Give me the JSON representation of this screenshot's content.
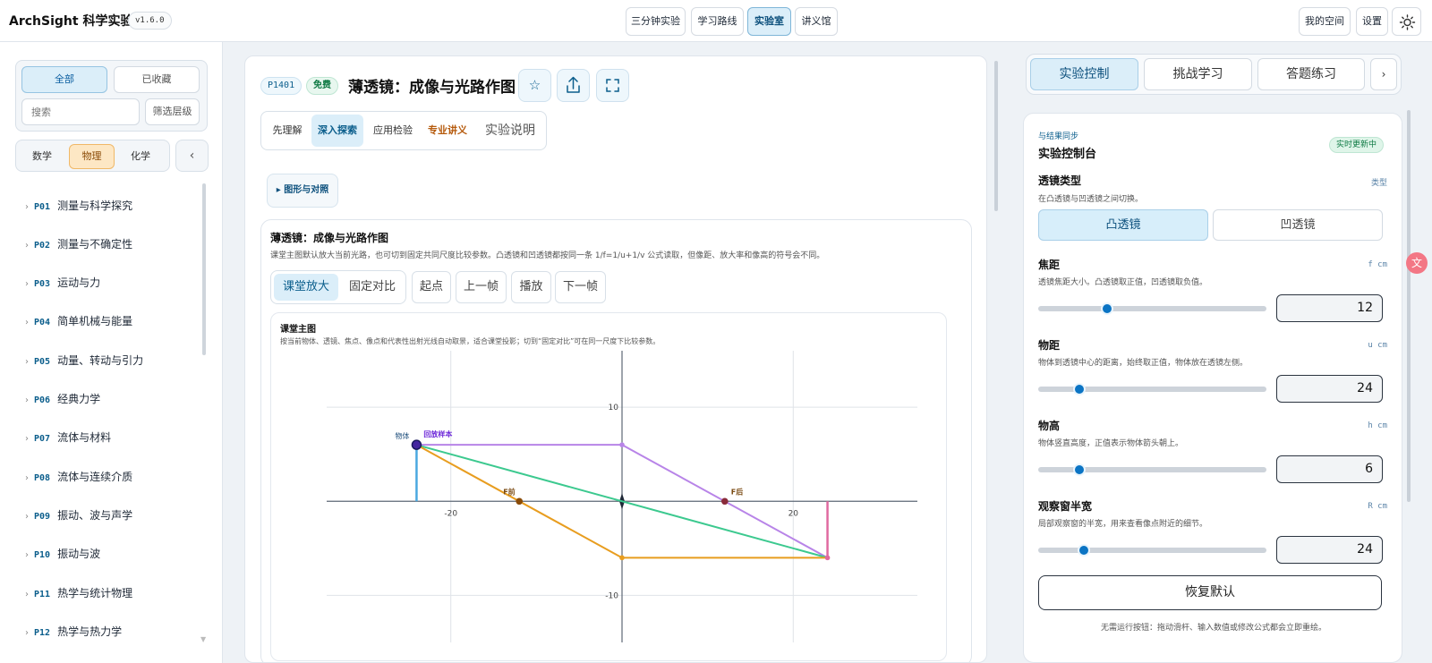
{
  "header": {
    "brand": "ArchSight 科学实验室",
    "version": "v1.6.0",
    "nav": [
      "三分钟实验",
      "学习路线",
      "实验室",
      "讲义馆"
    ],
    "nav_active": "实验室",
    "right": [
      "我的空间",
      "设置"
    ]
  },
  "sidebar": {
    "filter_all": "全部",
    "filter_fav": "已收藏",
    "search_placeholder": "搜索",
    "filter_level": "筛选层级",
    "subjects": [
      "数学",
      "物理",
      "化学"
    ],
    "subject_active": "物理",
    "collapse": "‹",
    "topics": [
      {
        "code": "P01",
        "name": "测量与科学探究"
      },
      {
        "code": "P02",
        "name": "测量与不确定性"
      },
      {
        "code": "P03",
        "name": "运动与力"
      },
      {
        "code": "P04",
        "name": "简单机械与能量"
      },
      {
        "code": "P05",
        "name": "动量、转动与引力"
      },
      {
        "code": "P06",
        "name": "经典力学"
      },
      {
        "code": "P07",
        "name": "流体与材料"
      },
      {
        "code": "P08",
        "name": "流体与连续介质"
      },
      {
        "code": "P09",
        "name": "振动、波与声学"
      },
      {
        "code": "P10",
        "name": "振动与波"
      },
      {
        "code": "P11",
        "name": "热学与统计物理"
      },
      {
        "code": "P12",
        "name": "热学与热力学"
      }
    ]
  },
  "experiment": {
    "code": "P1401",
    "badge": "免费",
    "title": "薄透镜：成像与光路作图",
    "tabs": [
      "先理解",
      "深入探索",
      "应用检验",
      "专业讲义",
      "实验说明"
    ],
    "tab_active": "深入探索",
    "disclosure": "▸ 图形与对照",
    "card_title": "薄透镜：成像与光路作图",
    "card_desc": "课堂主图默认放大当前光路，也可切到固定共同尺度比较参数。凸透镜和凹透镜都按同一条 1/f=1/u+1/v 公式读取，但像距、放大率和像高的符号会不同。",
    "view_modes": [
      "课堂放大",
      "固定对比"
    ],
    "view_active": "课堂放大",
    "playback": [
      "起点",
      "上一帧",
      "播放",
      "下一帧"
    ],
    "chart_title": "课堂主图",
    "chart_desc": "按当前物体、透镜、焦点、像点和代表性出射光线自动取景，适合课堂投影；切到“固定对比”可在同一尺度下比较参数。"
  },
  "chart_data": {
    "type": "line",
    "title": "",
    "xlabel": "",
    "ylabel": "",
    "xlim": [
      -34.5,
      34.5
    ],
    "ylim": [
      -15,
      16
    ],
    "xticks": [
      -20,
      20
    ],
    "yticks": [
      10,
      -10
    ],
    "grid": true,
    "labels": {
      "object": "物体",
      "sample": "回放样本",
      "f_front": "F前",
      "f_back": "F后"
    },
    "object": {
      "x": -24,
      "y0": 0,
      "y1": 6
    },
    "image": {
      "x": 24,
      "y0": 0,
      "y1": -6
    },
    "focal_front": {
      "x": -12,
      "y": 0
    },
    "focal_back": {
      "x": 12,
      "y": 0
    },
    "colors": {
      "object": "#4aa8e0",
      "image": "#e06aa0",
      "ray_parallel": "#b884e8",
      "ray_center": "#3cc98f",
      "ray_focal": "#e89d1f",
      "axis": "#5d6875",
      "grid": "#dfe3e8"
    },
    "series": [
      {
        "points": [
          [
            -24,
            6
          ],
          [
            0,
            6
          ],
          [
            24,
            -6
          ]
        ]
      },
      {
        "points": [
          [
            -24,
            6
          ],
          [
            24,
            -6
          ]
        ]
      },
      {
        "points": [
          [
            -24,
            6
          ],
          [
            0,
            -6
          ],
          [
            24,
            -6
          ]
        ]
      }
    ]
  },
  "controls": {
    "tabs": [
      "实验控制",
      "挑战学习",
      "答题练习",
      "›"
    ],
    "tab_active": "实验控制",
    "eyebrow": "与结果同步",
    "title": "实验控制台",
    "status": "实时更新中",
    "lens_label": "透镜类型",
    "lens_unit": "类型",
    "lens_desc": "在凸透镜与凹透镜之间切换。",
    "lens_options": [
      "凸透镜",
      "凹透镜"
    ],
    "lens_active": "凸透镜",
    "sliders": [
      {
        "label": "焦距",
        "unit": "f cm",
        "desc": "透镜焦距大小。凸透镜取正值，凹透镜取负值。",
        "value": "12",
        "position": 0.3
      },
      {
        "label": "物距",
        "unit": "u cm",
        "desc": "物体到透镜中心的距离，始终取正值，物体放在透镜左侧。",
        "value": "24",
        "position": 0.18
      },
      {
        "label": "物高",
        "unit": "h cm",
        "desc": "物体竖直高度，正值表示物体箭头朝上。",
        "value": "6",
        "position": 0.18
      },
      {
        "label": "观察窗半宽",
        "unit": "R cm",
        "desc": "局部观察窗的半宽，用来查看像点附近的细节。",
        "value": "24",
        "position": 0.2
      }
    ],
    "reset": "恢复默认",
    "footnote": "无需运行按钮：拖动滑杆、输入数值或修改公式都会立即重绘。"
  },
  "float_badge": "文"
}
